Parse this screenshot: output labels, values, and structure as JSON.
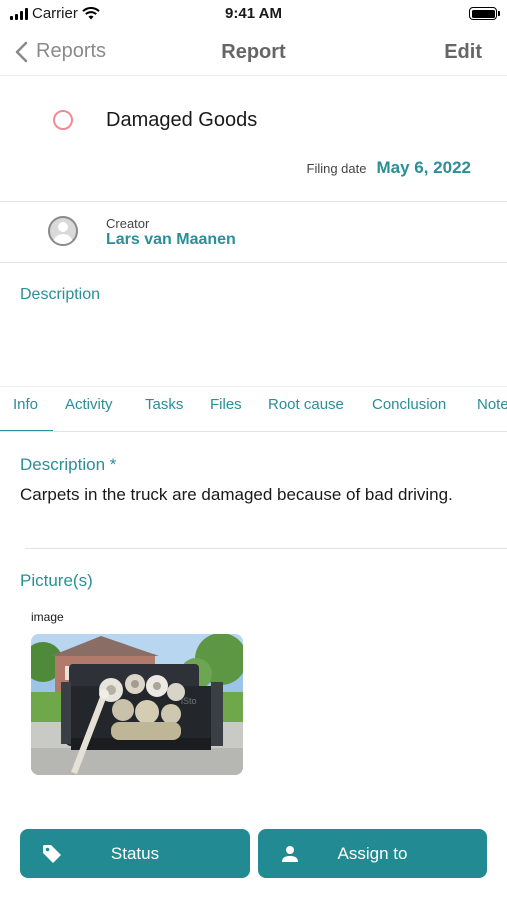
{
  "status_bar": {
    "carrier": "Carrier",
    "time": "9:41 AM"
  },
  "nav": {
    "back_label": "Reports",
    "title": "Report",
    "edit_label": "Edit"
  },
  "report": {
    "title": "Damaged Goods",
    "filing_label": "Filing date",
    "filing_date": "May 6, 2022",
    "creator_label": "Creator",
    "creator_name": "Lars van Maanen",
    "description_heading": "Description"
  },
  "tabs": [
    {
      "label": "Info"
    },
    {
      "label": "Activity"
    },
    {
      "label": "Tasks"
    },
    {
      "label": "Files"
    },
    {
      "label": "Root cause"
    },
    {
      "label": "Conclusion"
    },
    {
      "label": "Notes"
    }
  ],
  "info": {
    "description_label": "Description *",
    "description_text": "Carpets in the truck are damaged because of bad driving.",
    "pictures_label": "Picture(s)",
    "image_caption": "image"
  },
  "actions": {
    "status_label": "Status",
    "assign_label": "Assign to"
  },
  "colors": {
    "accent": "#2a8f97",
    "button": "#218a92",
    "status_circle": "#f08a95"
  }
}
